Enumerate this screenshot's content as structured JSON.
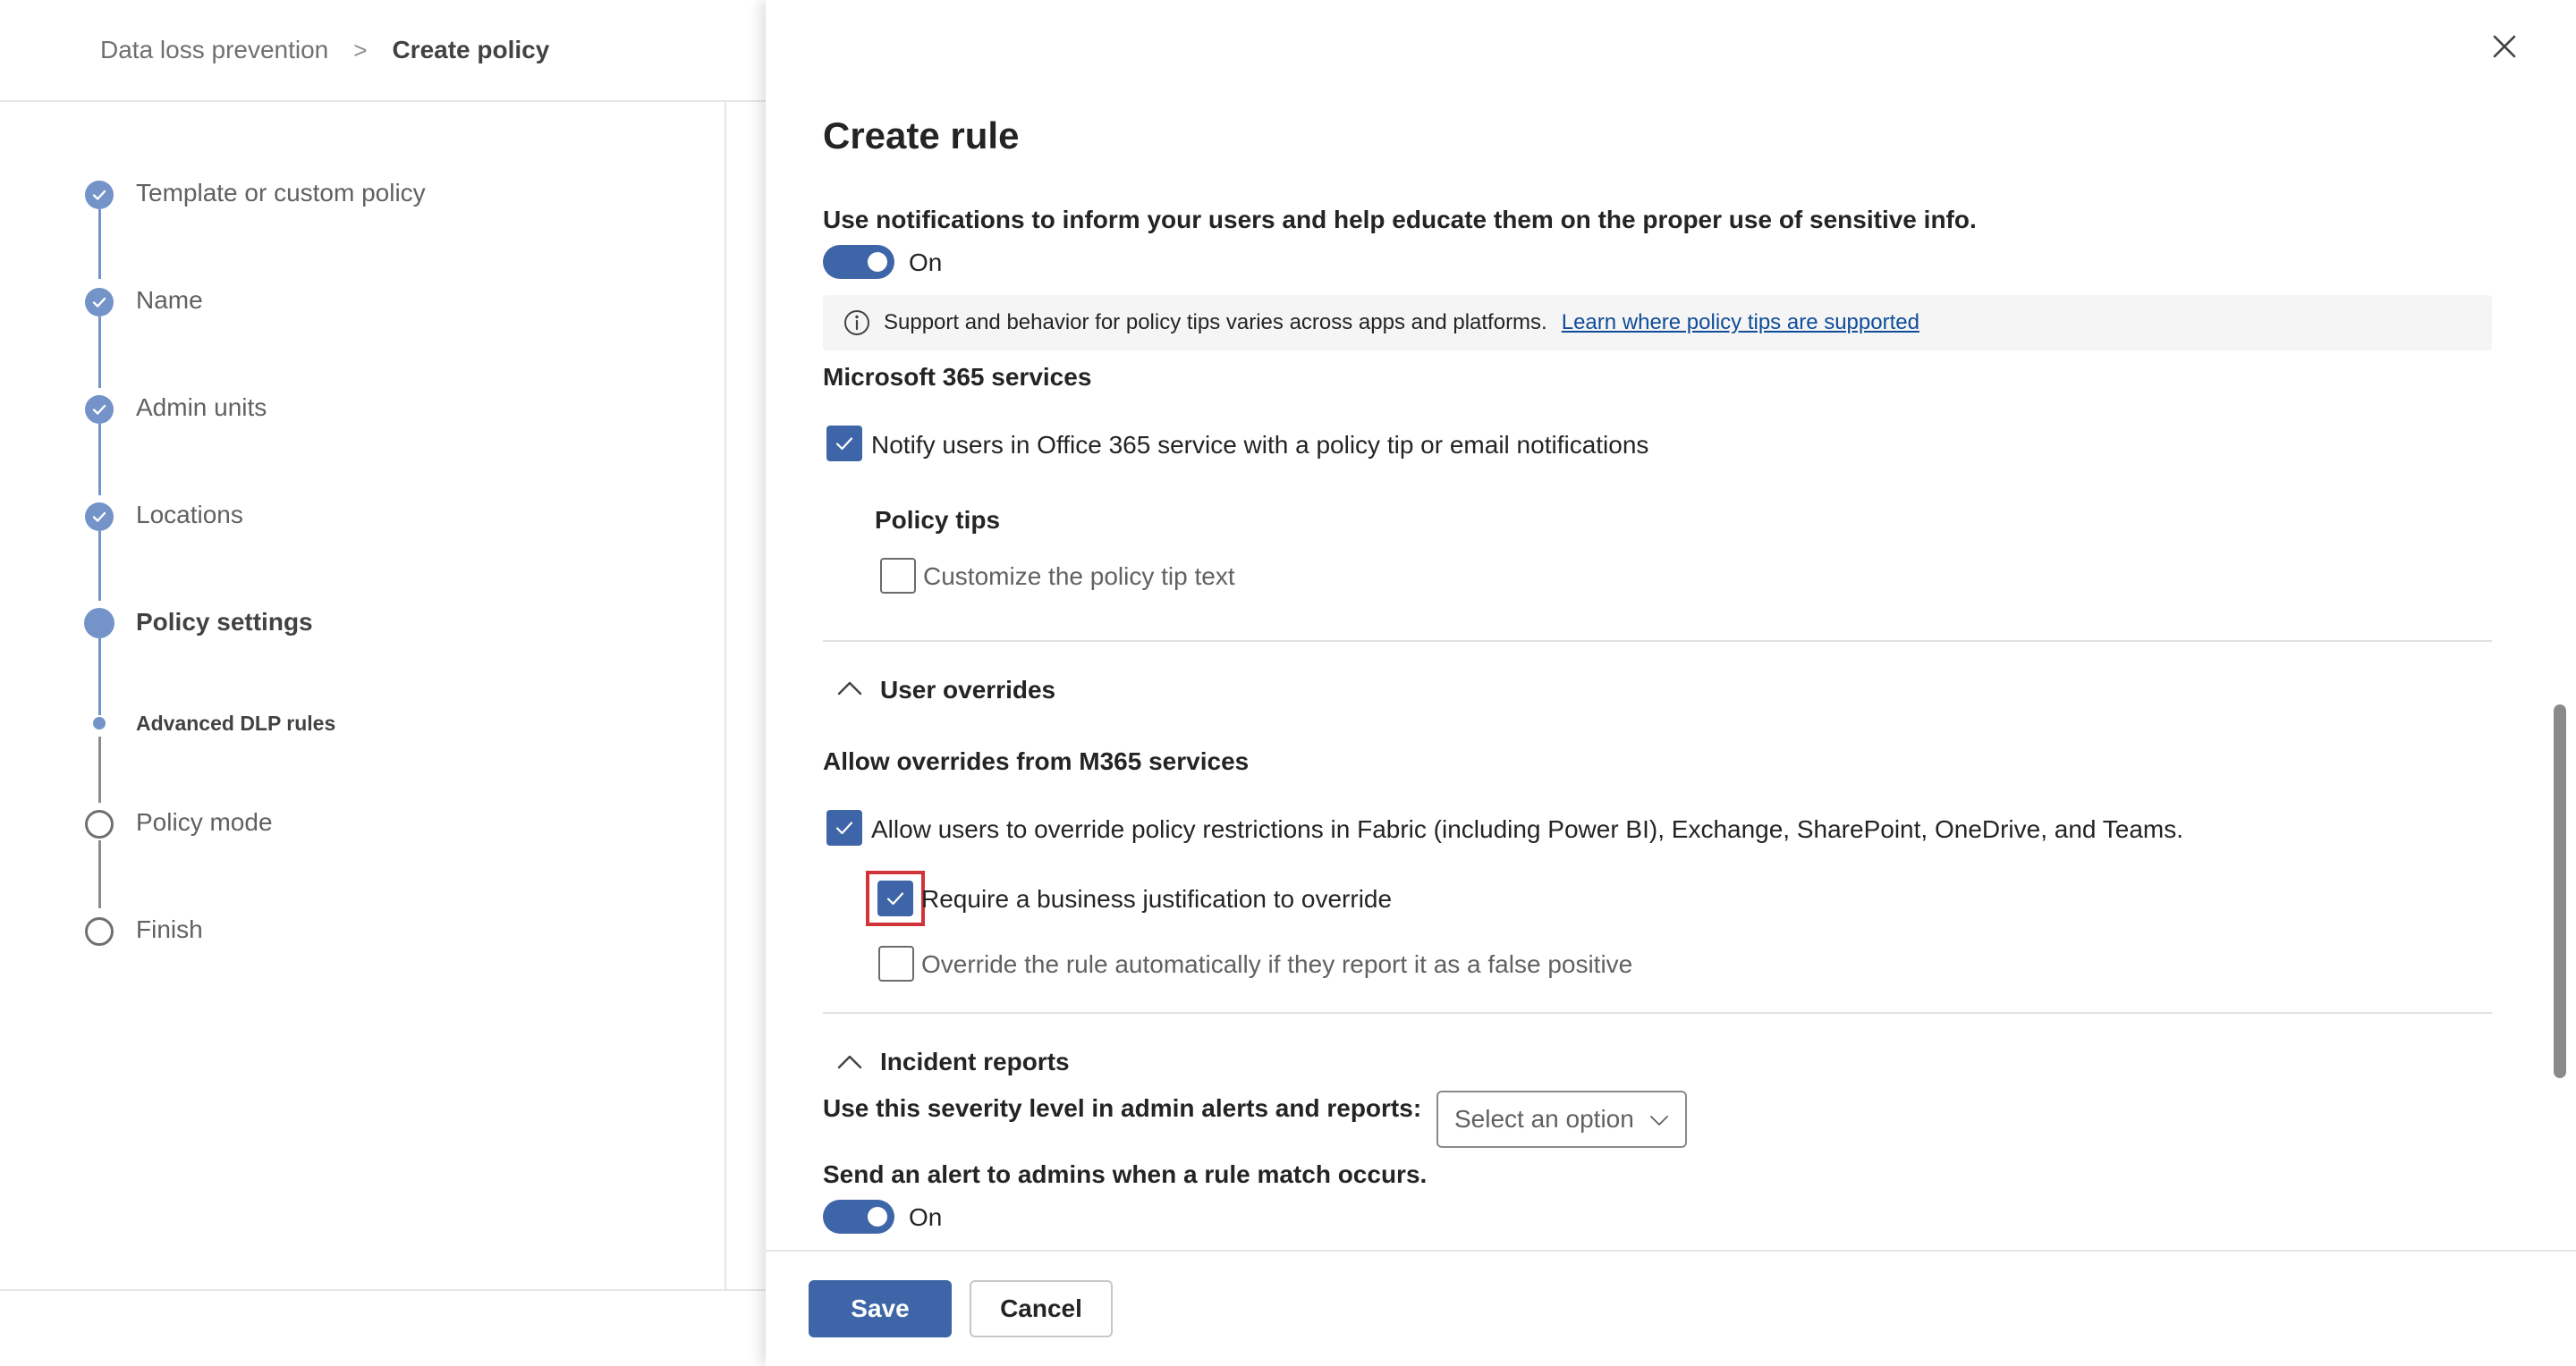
{
  "breadcrumb": {
    "parent": "Data loss prevention",
    "separator": ">",
    "current": "Create policy"
  },
  "wizard": {
    "steps": [
      {
        "label": "Template or custom policy",
        "state": "done"
      },
      {
        "label": "Name",
        "state": "done"
      },
      {
        "label": "Admin units",
        "state": "done"
      },
      {
        "label": "Locations",
        "state": "done"
      },
      {
        "label": "Policy settings",
        "state": "current"
      },
      {
        "label": "Advanced DLP rules",
        "state": "current-substep"
      },
      {
        "label": "Policy mode",
        "state": "todo"
      },
      {
        "label": "Finish",
        "state": "todo"
      }
    ]
  },
  "panel": {
    "title": "Create rule",
    "notifications": {
      "description": "Use notifications to inform your users and help educate them on the proper use of sensitive info.",
      "toggle_label": "On",
      "toggle_on": true
    },
    "info_bar": {
      "text": "Support and behavior for policy tips varies across apps and platforms.",
      "link": "Learn where policy tips are supported"
    },
    "m365_services": {
      "heading": "Microsoft 365 services",
      "notify_checkbox": {
        "label": "Notify users in Office 365 service with a policy tip or email notifications",
        "checked": true
      }
    },
    "policy_tips": {
      "heading": "Policy tips",
      "customize_checkbox": {
        "label": "Customize the policy tip text",
        "checked": false
      }
    },
    "user_overrides": {
      "heading": "User overrides",
      "expanded": true,
      "subheading": "Allow overrides from M365 services",
      "allow_checkbox": {
        "label": "Allow users to override policy restrictions in Fabric (including Power BI), Exchange, SharePoint, OneDrive, and Teams.",
        "checked": true
      },
      "justification_checkbox": {
        "label": "Require a business justification to override",
        "checked": true
      },
      "false_positive_checkbox": {
        "label": "Override the rule automatically if they report it as a false positive",
        "checked": false
      }
    },
    "incident_reports": {
      "heading": "Incident reports",
      "expanded": true,
      "severity_label": "Use this severity level in admin alerts and reports:",
      "severity_select": {
        "placeholder": "Select an option"
      },
      "alert_label": "Send an alert to admins when a rule match occurs.",
      "alert_toggle_label": "On",
      "alert_toggle_on": true
    },
    "footer": {
      "save_label": "Save",
      "cancel_label": "Cancel"
    }
  },
  "colors": {
    "accent": "#3d65a8",
    "stepper": "#7393c9",
    "highlight": "#d13438",
    "link": "#0f4c99"
  },
  "icons": {
    "close": "close-icon",
    "info": "info-icon",
    "checkmark": "checkmark-icon",
    "chevron_up": "chevron-up-icon",
    "chevron_down": "chevron-down-icon"
  }
}
